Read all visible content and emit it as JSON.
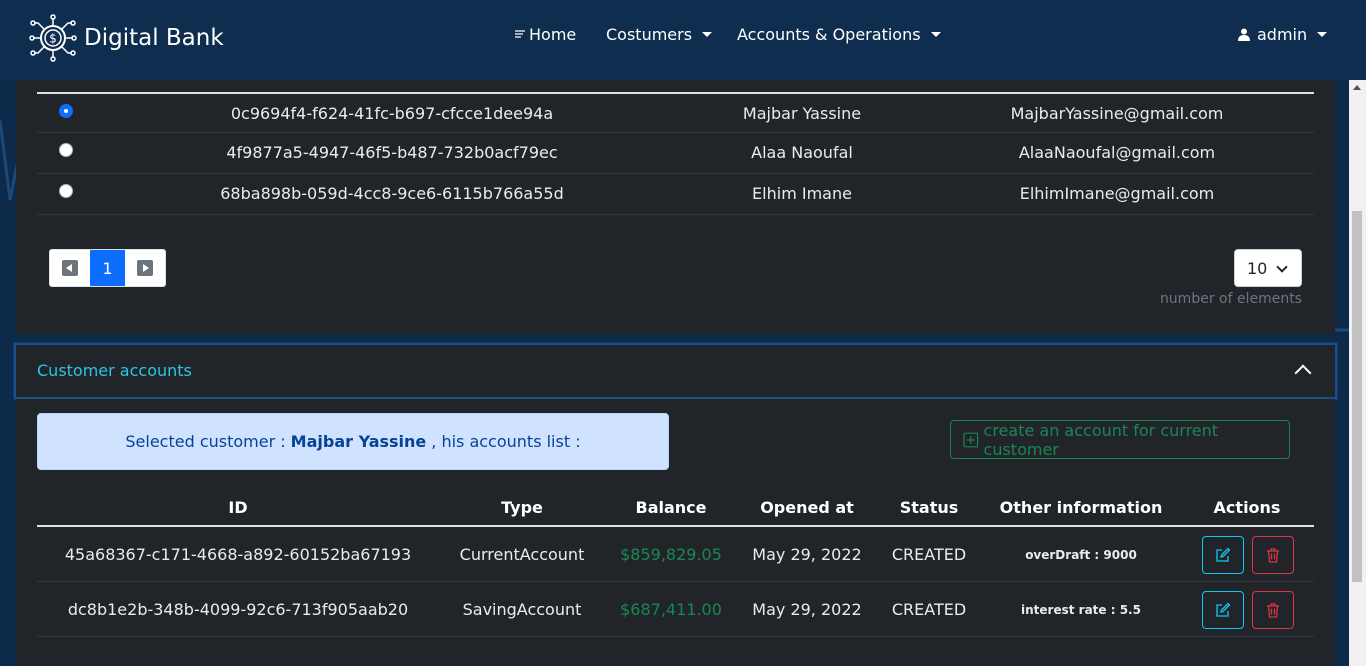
{
  "app": {
    "brand": "Digital Bank"
  },
  "nav": {
    "home": "Home",
    "customers": "Costumers",
    "accounts": "Accounts & Operations",
    "user": "admin"
  },
  "customers": {
    "rows": [
      {
        "id": "0c9694f4-f624-41fc-b697-cfcce1dee94a",
        "name": "Majbar Yassine",
        "email": "MajbarYassine@gmail.com",
        "selected": true
      },
      {
        "id": "4f9877a5-4947-46f5-b487-732b0acf79ec",
        "name": "Alaa Naoufal",
        "email": "AlaaNaoufal@gmail.com",
        "selected": false
      },
      {
        "id": "68ba898b-059d-4cc8-9ce6-6115b766a55d",
        "name": "Elhim Imane",
        "email": "ElhimImane@gmail.com",
        "selected": false
      }
    ],
    "pagination": {
      "current_page": "1"
    },
    "page_size": {
      "value": "10",
      "hint": "number of elements"
    }
  },
  "customer_accounts": {
    "title": "Customer accounts",
    "selected_prefix": "Selected customer :",
    "selected_name": "Majbar Yassine",
    "selected_suffix": ", his accounts list :",
    "create_button": "create an account for current customer",
    "columns": {
      "id": "ID",
      "type": "Type",
      "balance": "Balance",
      "opened": "Opened at",
      "status": "Status",
      "info": "Other information",
      "actions": "Actions"
    },
    "rows": [
      {
        "id": "45a68367-c171-4668-a892-60152ba67193",
        "type": "CurrentAccount",
        "balance": "$859,829.05",
        "opened": "May 29, 2022",
        "status": "CREATED",
        "info": "overDraft : 9000"
      },
      {
        "id": "dc8b1e2b-348b-4099-92c6-713f905aab20",
        "type": "SavingAccount",
        "balance": "$687,411.00",
        "opened": "May 29, 2022",
        "status": "CREATED",
        "info": "interest rate : 5.5"
      }
    ]
  },
  "colors": {
    "navbar": "#0f2d4e",
    "panel": "#212529",
    "accent": "#0d6efd",
    "success": "#198754",
    "info": "#0dcaf0",
    "danger": "#dc3545",
    "accordion_title": "#2ec4e6"
  },
  "icons": {
    "logo": "dollar-circuit-icon",
    "home": "menu-lines-icon",
    "user": "user-icon",
    "prev": "caret-left-square-icon",
    "next": "caret-right-square-icon",
    "collapse": "chevron-up-icon",
    "create": "plus-square-icon",
    "edit": "pencil-square-icon",
    "delete": "trash-icon"
  }
}
